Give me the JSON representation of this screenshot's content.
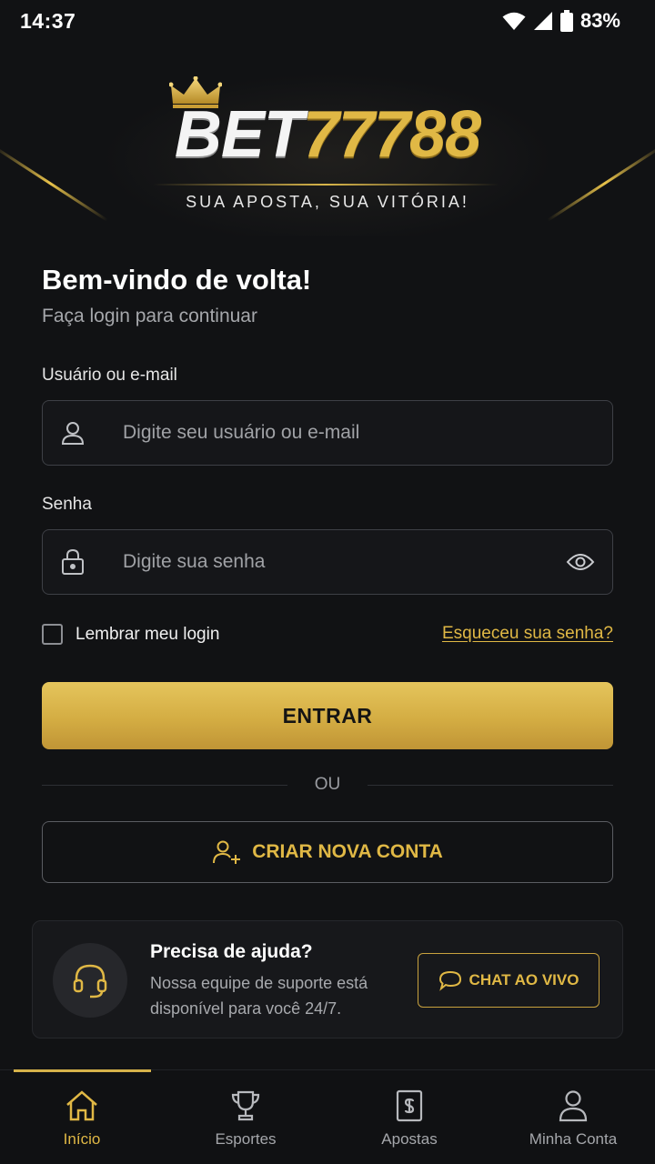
{
  "status_bar": {
    "time": "14:37",
    "battery": "83%"
  },
  "brand": {
    "name_white": "BET",
    "name_gold": "77788",
    "tagline": "SUA APOSTA, SUA VITÓRIA!"
  },
  "login": {
    "title": "Bem-vindo de volta!",
    "subtitle": "Faça login para continuar",
    "username_label": "Usuário ou e-mail",
    "username_placeholder": "Digite seu usuário ou e-mail",
    "password_label": "Senha",
    "password_placeholder": "Digite sua senha",
    "remember_label": "Lembrar meu login",
    "remember_checked": false,
    "forgot_link": "Esqueceu sua senha?",
    "submit_label": "ENTRAR",
    "divider_text": "OU",
    "create_account_label": "CRIAR NOVA CONTA"
  },
  "help": {
    "title": "Precisa de ajuda?",
    "text": "Nossa equipe de suporte está disponível para você 24/7.",
    "chat_label": "CHAT AO VIVO"
  },
  "bottom_nav": {
    "items": [
      {
        "label": "Início",
        "icon": "home-icon",
        "active": true
      },
      {
        "label": "Esportes",
        "icon": "trophy-icon",
        "active": false
      },
      {
        "label": "Apostas",
        "icon": "bet-slip-icon",
        "active": false
      },
      {
        "label": "Minha Conta",
        "icon": "user-icon",
        "active": false
      }
    ]
  },
  "colors": {
    "accent_gold": "#e0b845",
    "background": "#111214",
    "field_border": "#3e4046"
  }
}
